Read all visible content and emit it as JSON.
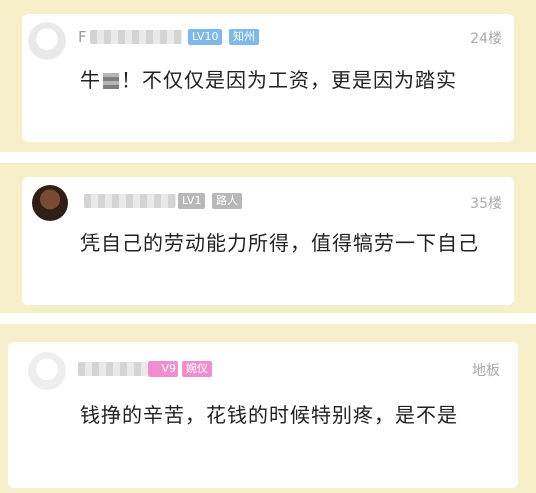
{
  "comments": [
    {
      "user_prefix": "F",
      "level": "LV10",
      "title": "知州",
      "floor": "24楼",
      "text_before_censor": "牛",
      "text_after_censor": "！不仅仅是因为工资，更是因为踏实"
    },
    {
      "user_prefix": "",
      "level": "LV1",
      "title": "路人",
      "floor": "35楼",
      "text": "凭自己的劳动能力所得，值得犒劳一下自己"
    },
    {
      "user_prefix": "",
      "level": "V9",
      "title": "婉仪",
      "floor": "地板",
      "text": "钱挣的辛苦，花钱的时候特别疼，是不是"
    }
  ],
  "colors": {
    "panel_bg": "#f7efc9",
    "badge_blue": "#7fb9ec",
    "badge_gray": "#b8b8b8",
    "badge_pink": "#ef8fcf"
  }
}
